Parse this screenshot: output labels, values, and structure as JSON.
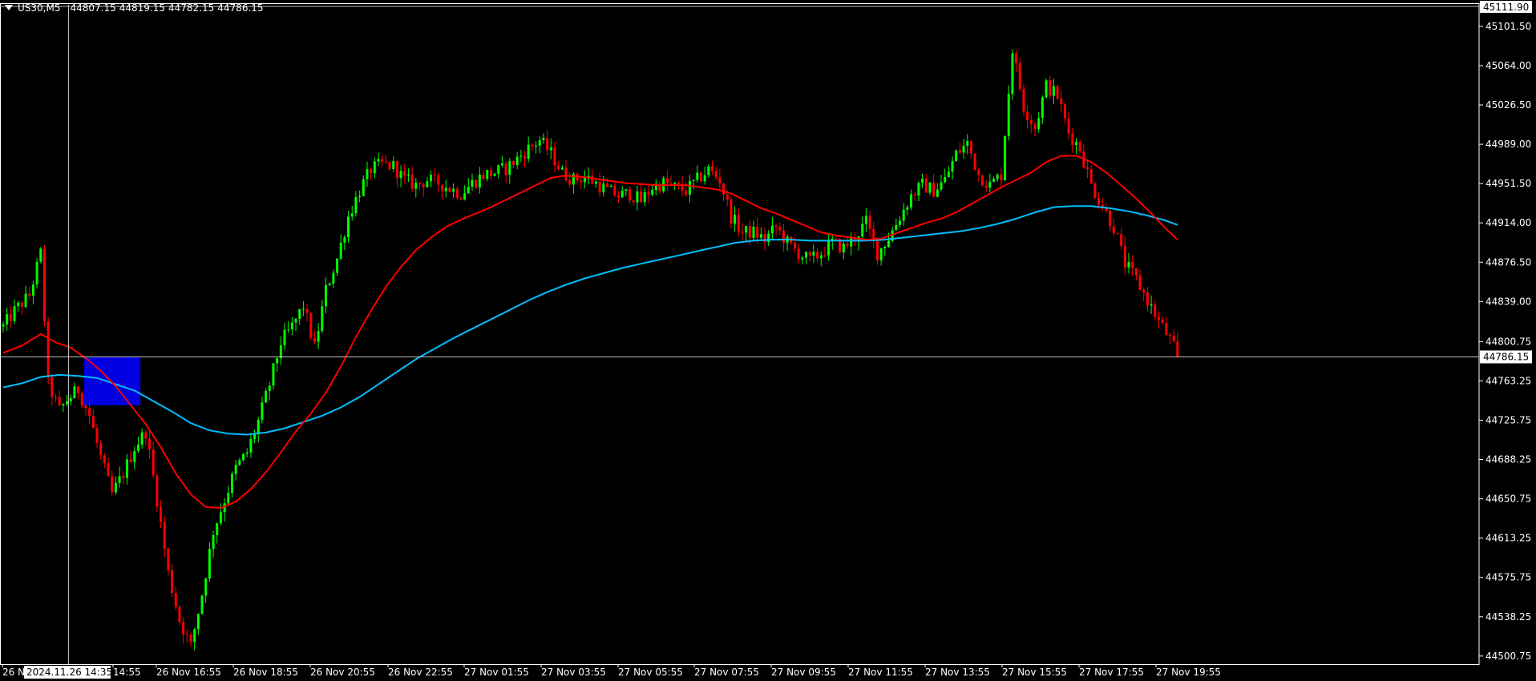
{
  "header": {
    "symbol": "US30,M5",
    "ohlc": [
      "44807.15",
      "44819.15",
      "44782.15",
      "44786.15"
    ]
  },
  "colors": {
    "background": "#000000",
    "bull": "#00ff00",
    "bear": "#ff0000",
    "ma_fast": "#ff0000",
    "ma_slow": "#00bfff",
    "zone": "#0000e0",
    "grid_line": "#c0c0c0"
  },
  "icons": {
    "dropdown": "triangle-down-icon"
  },
  "chart_data": {
    "type": "candlestick",
    "title": "US30,M5",
    "y_ticks": [
      "45101.50",
      "45064.00",
      "45026.50",
      "44989.00",
      "44951.50",
      "44914.00",
      "44876.50",
      "44839.00",
      "44800.75",
      "44763.25",
      "44725.75",
      "44688.25",
      "44650.75",
      "44613.25",
      "44575.75",
      "44538.25",
      "44500.75"
    ],
    "ylim": [
      44493,
      45119
    ],
    "x_ticks": [
      "26 N",
      "14:55",
      "26 Nov 16:55",
      "26 Nov 18:55",
      "26 Nov 20:55",
      "26 Nov 22:55",
      "27 Nov 01:55",
      "27 Nov 03:55",
      "27 Nov 05:55",
      "27 Nov 07:55",
      "27 Nov 09:55",
      "27 Nov 11:55",
      "27 Nov 13:55",
      "27 Nov 15:55",
      "27 Nov 17:55",
      "27 Nov 19:55"
    ],
    "crosshair_time_label": "2024.11.26 14:35",
    "top_price_label": "45111.90",
    "current_price": 44786.15,
    "current_price_label": "44786.15",
    "zone": {
      "price_top": 44786,
      "price_bottom": 44740,
      "bar_start": 22,
      "bar_end": 37
    },
    "close_path": [
      [
        0,
        44815
      ],
      [
        3,
        44830
      ],
      [
        7,
        44845
      ],
      [
        10,
        44885
      ],
      [
        12,
        44760
      ],
      [
        15,
        44735
      ],
      [
        17,
        44745
      ],
      [
        20,
        44755
      ],
      [
        23,
        44730
      ],
      [
        26,
        44690
      ],
      [
        29,
        44655
      ],
      [
        32,
        44675
      ],
      [
        35,
        44700
      ],
      [
        38,
        44715
      ],
      [
        41,
        44650
      ],
      [
        44,
        44580
      ],
      [
        47,
        44535
      ],
      [
        50,
        44510
      ],
      [
        53,
        44560
      ],
      [
        56,
        44620
      ],
      [
        59,
        44650
      ],
      [
        62,
        44680
      ],
      [
        65,
        44695
      ],
      [
        68,
        44725
      ],
      [
        71,
        44760
      ],
      [
        74,
        44800
      ],
      [
        77,
        44815
      ],
      [
        80,
        44835
      ],
      [
        83,
        44795
      ],
      [
        86,
        44850
      ],
      [
        89,
        44880
      ],
      [
        92,
        44920
      ],
      [
        95,
        44945
      ],
      [
        98,
        44965
      ],
      [
        101,
        44970
      ],
      [
        104,
        44968
      ],
      [
        107,
        44955
      ],
      [
        110,
        44950
      ],
      [
        113,
        44955
      ],
      [
        116,
        44952
      ],
      [
        119,
        44947
      ],
      [
        122,
        44942
      ],
      [
        125,
        44952
      ],
      [
        128,
        44960
      ],
      [
        131,
        44962
      ],
      [
        134,
        44966
      ],
      [
        137,
        44975
      ],
      [
        140,
        44985
      ],
      [
        143,
        44993
      ],
      [
        146,
        44980
      ],
      [
        149,
        44962
      ],
      [
        152,
        44955
      ],
      [
        155,
        44958
      ],
      [
        158,
        44952
      ],
      [
        161,
        44945
      ],
      [
        164,
        44940
      ],
      [
        167,
        44942
      ],
      [
        170,
        44935
      ],
      [
        173,
        44948
      ],
      [
        176,
        44952
      ],
      [
        179,
        44948
      ],
      [
        182,
        44945
      ],
      [
        185,
        44955
      ],
      [
        188,
        44965
      ],
      [
        191,
        44955
      ],
      [
        194,
        44920
      ],
      [
        197,
        44905
      ],
      [
        200,
        44905
      ],
      [
        203,
        44898
      ],
      [
        206,
        44910
      ],
      [
        209,
        44895
      ],
      [
        212,
        44885
      ],
      [
        215,
        44878
      ],
      [
        218,
        44885
      ],
      [
        221,
        44895
      ],
      [
        224,
        44890
      ],
      [
        227,
        44900
      ],
      [
        230,
        44915
      ],
      [
        233,
        44885
      ],
      [
        236,
        44900
      ],
      [
        239,
        44920
      ],
      [
        242,
        44940
      ],
      [
        245,
        44950
      ],
      [
        248,
        44945
      ],
      [
        251,
        44955
      ],
      [
        254,
        44980
      ],
      [
        257,
        44990
      ],
      [
        260,
        44960
      ],
      [
        263,
        44950
      ],
      [
        266,
        44960
      ],
      [
        269,
        45080
      ],
      [
        272,
        45025
      ],
      [
        275,
        45005
      ],
      [
        278,
        45045
      ],
      [
        281,
        45035
      ],
      [
        284,
        45000
      ],
      [
        287,
        44985
      ],
      [
        290,
        44950
      ],
      [
        293,
        44930
      ],
      [
        296,
        44910
      ],
      [
        299,
        44875
      ],
      [
        302,
        44860
      ],
      [
        305,
        44840
      ],
      [
        308,
        44820
      ],
      [
        311,
        44803
      ],
      [
        313,
        44786
      ]
    ],
    "ma_fast": [
      [
        0,
        44790
      ],
      [
        5,
        44797
      ],
      [
        10,
        44808
      ],
      [
        14,
        44800
      ],
      [
        18,
        44795
      ],
      [
        22,
        44785
      ],
      [
        26,
        44773
      ],
      [
        30,
        44758
      ],
      [
        34,
        44740
      ],
      [
        38,
        44722
      ],
      [
        42,
        44700
      ],
      [
        46,
        44675
      ],
      [
        50,
        44655
      ],
      [
        54,
        44643
      ],
      [
        58,
        44642
      ],
      [
        62,
        44648
      ],
      [
        66,
        44660
      ],
      [
        70,
        44676
      ],
      [
        74,
        44695
      ],
      [
        78,
        44715
      ],
      [
        82,
        44732
      ],
      [
        86,
        44752
      ],
      [
        90,
        44777
      ],
      [
        94,
        44805
      ],
      [
        98,
        44830
      ],
      [
        102,
        44853
      ],
      [
        106,
        44872
      ],
      [
        110,
        44888
      ],
      [
        114,
        44900
      ],
      [
        118,
        44910
      ],
      [
        122,
        44917
      ],
      [
        126,
        44923
      ],
      [
        130,
        44929
      ],
      [
        134,
        44936
      ],
      [
        138,
        44943
      ],
      [
        142,
        44950
      ],
      [
        146,
        44957
      ],
      [
        150,
        44959
      ],
      [
        154,
        44958
      ],
      [
        158,
        44956
      ],
      [
        162,
        44954
      ],
      [
        166,
        44952
      ],
      [
        170,
        44951
      ],
      [
        174,
        44950
      ],
      [
        178,
        44950
      ],
      [
        182,
        44950
      ],
      [
        186,
        44948
      ],
      [
        190,
        44946
      ],
      [
        194,
        44942
      ],
      [
        198,
        44935
      ],
      [
        202,
        44928
      ],
      [
        206,
        44923
      ],
      [
        210,
        44917
      ],
      [
        214,
        44911
      ],
      [
        218,
        44905
      ],
      [
        222,
        44902
      ],
      [
        226,
        44900
      ],
      [
        230,
        44898
      ],
      [
        234,
        44899
      ],
      [
        238,
        44904
      ],
      [
        242,
        44909
      ],
      [
        246,
        44914
      ],
      [
        250,
        44918
      ],
      [
        254,
        44924
      ],
      [
        258,
        44932
      ],
      [
        262,
        44940
      ],
      [
        266,
        44948
      ],
      [
        270,
        44955
      ],
      [
        274,
        44962
      ],
      [
        278,
        44972
      ],
      [
        282,
        44978
      ],
      [
        286,
        44978
      ],
      [
        290,
        44972
      ],
      [
        294,
        44962
      ],
      [
        298,
        44950
      ],
      [
        302,
        44937
      ],
      [
        306,
        44923
      ],
      [
        310,
        44908
      ],
      [
        313,
        44898
      ]
    ],
    "ma_slow": [
      [
        0,
        44757
      ],
      [
        5,
        44761
      ],
      [
        10,
        44767
      ],
      [
        15,
        44769
      ],
      [
        20,
        44768
      ],
      [
        25,
        44766
      ],
      [
        30,
        44760
      ],
      [
        35,
        44754
      ],
      [
        40,
        44744
      ],
      [
        45,
        44734
      ],
      [
        50,
        44723
      ],
      [
        55,
        44716
      ],
      [
        60,
        44713
      ],
      [
        65,
        44712
      ],
      [
        70,
        44714
      ],
      [
        75,
        44718
      ],
      [
        80,
        44724
      ],
      [
        85,
        44730
      ],
      [
        90,
        44738
      ],
      [
        95,
        44748
      ],
      [
        100,
        44760
      ],
      [
        105,
        44772
      ],
      [
        110,
        44784
      ],
      [
        115,
        44794
      ],
      [
        120,
        44804
      ],
      [
        125,
        44813
      ],
      [
        130,
        44822
      ],
      [
        135,
        44831
      ],
      [
        140,
        44840
      ],
      [
        145,
        44848
      ],
      [
        150,
        44855
      ],
      [
        155,
        44861
      ],
      [
        160,
        44866
      ],
      [
        165,
        44871
      ],
      [
        170,
        44875
      ],
      [
        175,
        44879
      ],
      [
        180,
        44883
      ],
      [
        185,
        44887
      ],
      [
        190,
        44891
      ],
      [
        195,
        44895
      ],
      [
        200,
        44897
      ],
      [
        205,
        44898
      ],
      [
        210,
        44898
      ],
      [
        215,
        44897
      ],
      [
        220,
        44897
      ],
      [
        225,
        44897
      ],
      [
        230,
        44897
      ],
      [
        235,
        44898
      ],
      [
        240,
        44900
      ],
      [
        245,
        44902
      ],
      [
        250,
        44904
      ],
      [
        255,
        44906
      ],
      [
        260,
        44909
      ],
      [
        265,
        44913
      ],
      [
        270,
        44918
      ],
      [
        275,
        44924
      ],
      [
        280,
        44929
      ],
      [
        285,
        44930
      ],
      [
        290,
        44930
      ],
      [
        295,
        44928
      ],
      [
        300,
        44925
      ],
      [
        305,
        44921
      ],
      [
        310,
        44916
      ],
      [
        313,
        44912
      ]
    ]
  }
}
